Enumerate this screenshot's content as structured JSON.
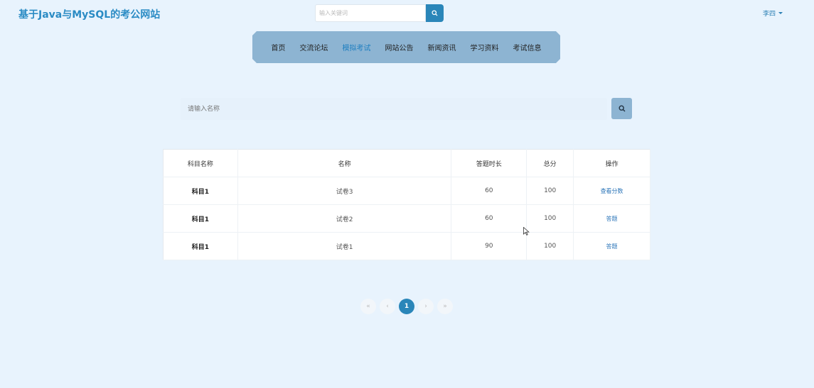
{
  "header": {
    "site_title": "基于Java与MySQL的考公网站",
    "search_placeholder": "输入关键词",
    "user_name": "李四"
  },
  "nav": {
    "items": [
      "首页",
      "交流论坛",
      "模拟考试",
      "网站公告",
      "新闻资讯",
      "学习资料",
      "考试信息"
    ],
    "active": "模拟考试"
  },
  "search": {
    "placeholder": "请输入名称"
  },
  "table": {
    "headers": [
      "科目名称",
      "名称",
      "答题时长",
      "总分",
      "操作"
    ],
    "rows": [
      {
        "subject": "科目1",
        "name": "试卷3",
        "duration": "60",
        "score": "100",
        "action": "查看分数"
      },
      {
        "subject": "科目1",
        "name": "试卷2",
        "duration": "60",
        "score": "100",
        "action": "答题"
      },
      {
        "subject": "科目1",
        "name": "试卷1",
        "duration": "90",
        "score": "100",
        "action": "答题"
      }
    ]
  },
  "pagination": {
    "first": "«",
    "prev": "‹",
    "current": "1",
    "next": "›",
    "last": "»"
  },
  "colors": {
    "accent": "#2a86b9",
    "nav_bg": "#8db4d2",
    "page_bg": "#e8f3fd"
  }
}
